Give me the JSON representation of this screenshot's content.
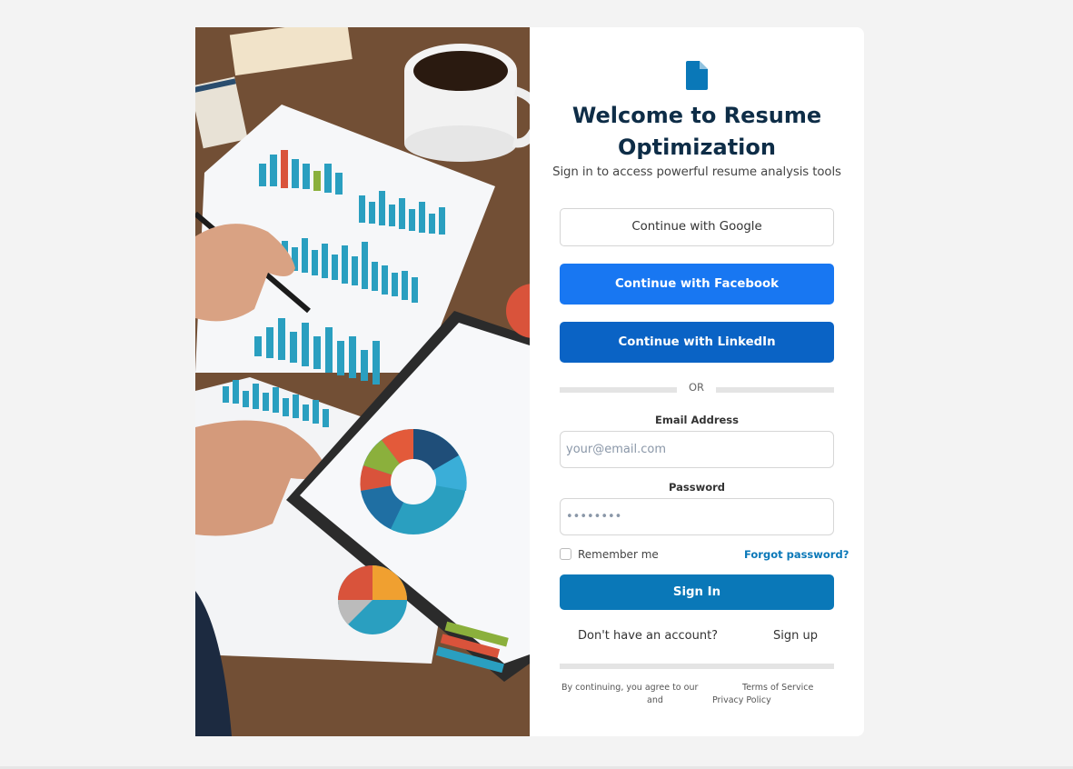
{
  "brand": {
    "accent": "#0a78b8",
    "title_color": "#0e2d47",
    "facebook": "#1877f2",
    "linkedin": "#0a63c5"
  },
  "hero": {
    "image": "illustration of desk with printed charts, tablet with pie chart, coffee cup and hands with pen"
  },
  "logo": {
    "icon": "document-icon"
  },
  "title": "Welcome to Resume Optimization",
  "subtitle": "Sign in to access powerful resume analysis tools",
  "social": {
    "google": "Continue with Google",
    "facebook": "Continue with Facebook",
    "linkedin": "Continue with LinkedIn"
  },
  "divider": "OR",
  "form": {
    "email_label": "Email Address",
    "email_placeholder": "your@email.com",
    "password_label": "Password",
    "password_placeholder": "••••••••",
    "remember": "Remember me",
    "remember_checked": false,
    "forgot": "Forgot password?",
    "submit": "Sign In"
  },
  "signup": {
    "prompt": "Don't have an account?",
    "link": "Sign up"
  },
  "legal": {
    "prefix": "By continuing, you agree to our",
    "terms": "Terms of Service",
    "and": "and",
    "privacy": "Privacy Policy"
  }
}
